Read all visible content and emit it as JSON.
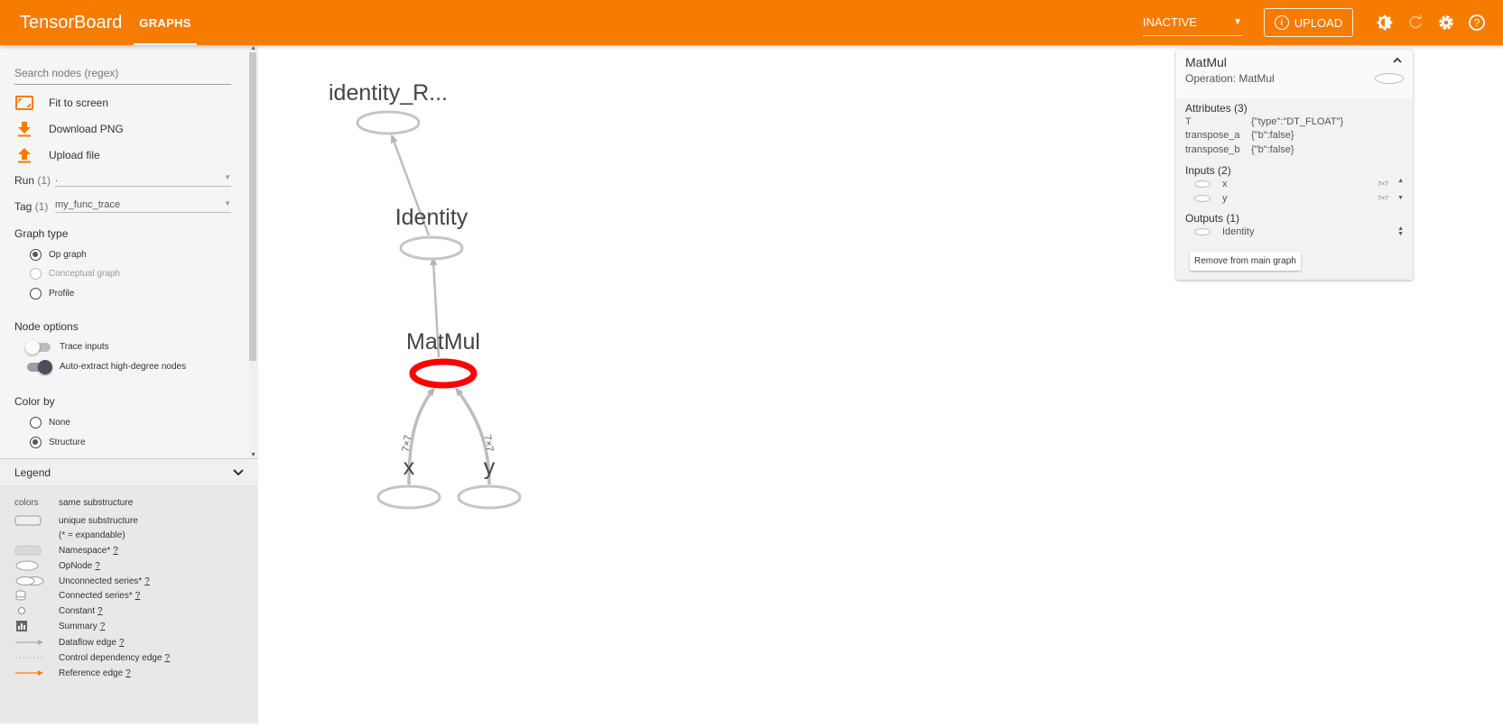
{
  "app": {
    "title": "TensorBoard"
  },
  "tabs": [
    {
      "label": "GRAPHS"
    }
  ],
  "topbar": {
    "status_value": "INACTIVE",
    "upload_label": "UPLOAD",
    "icons": [
      "theme-toggle-icon",
      "refresh-icon",
      "settings-icon",
      "help-icon"
    ],
    "accent_color": "#f57c00"
  },
  "sidebar": {
    "search_placeholder": "Search nodes (regex)",
    "actions": [
      {
        "label": "Fit to screen",
        "icon": "fit-screen-icon"
      },
      {
        "label": "Download PNG",
        "icon": "download-icon"
      },
      {
        "label": "Upload file",
        "icon": "upload-icon"
      }
    ],
    "run": {
      "label": "Run",
      "count": "(1)",
      "value": "."
    },
    "tag": {
      "label": "Tag",
      "count": "(1)",
      "value": "my_func_trace"
    },
    "graph_type": {
      "title": "Graph type",
      "options": [
        {
          "label": "Op graph",
          "checked": true,
          "disabled": false
        },
        {
          "label": "Conceptual graph",
          "checked": false,
          "disabled": true
        },
        {
          "label": "Profile",
          "checked": false,
          "disabled": false
        }
      ]
    },
    "node_options": {
      "title": "Node options",
      "toggles": [
        {
          "label": "Trace inputs",
          "on": false
        },
        {
          "label": "Auto-extract high-degree nodes",
          "on": true
        }
      ]
    },
    "color_by": {
      "title": "Color by",
      "options": [
        {
          "label": "None",
          "checked": false
        },
        {
          "label": "Structure",
          "checked": true
        }
      ]
    }
  },
  "legend": {
    "title": "Legend",
    "rows": [
      {
        "symbol": "colors",
        "label": "same substructure",
        "help": ""
      },
      {
        "symbol": "rounded-rect",
        "label": "unique substructure",
        "help": ""
      },
      {
        "symbol": "",
        "label": "(* = expandable)",
        "help": ""
      },
      {
        "symbol": "namespace-box",
        "label": "Namespace*",
        "help": "?"
      },
      {
        "symbol": "ellipse",
        "label": "OpNode",
        "help": "?"
      },
      {
        "symbol": "double-ellipse",
        "label": "Unconnected series*",
        "help": "?"
      },
      {
        "symbol": "stack",
        "label": "Connected series*",
        "help": "?"
      },
      {
        "symbol": "circle",
        "label": "Constant",
        "help": "?"
      },
      {
        "symbol": "summary",
        "label": "Summary",
        "help": "?"
      },
      {
        "symbol": "arrow",
        "label": "Dataflow edge",
        "help": "?"
      },
      {
        "symbol": "dashed",
        "label": "Control dependency edge",
        "help": "?"
      },
      {
        "symbol": "orange-arrow",
        "label": "Reference edge",
        "help": "?"
      }
    ]
  },
  "graph": {
    "nodes": [
      {
        "id": "identity_r",
        "label": "identity_R..."
      },
      {
        "id": "identity",
        "label": "Identity"
      },
      {
        "id": "matmul",
        "label": "MatMul",
        "selected": true
      },
      {
        "id": "x",
        "label": "x"
      },
      {
        "id": "y",
        "label": "y"
      }
    ],
    "edges": [
      {
        "from": "x",
        "to": "matmul",
        "label": "7×7"
      },
      {
        "from": "y",
        "to": "matmul",
        "label": "7×7"
      },
      {
        "from": "matmul",
        "to": "identity",
        "label": ""
      },
      {
        "from": "identity",
        "to": "identity_r",
        "label": ""
      }
    ],
    "selected_color": "#ff0000"
  },
  "info_card": {
    "title": "MatMul",
    "operation": "Operation: MatMul",
    "attributes_title": "Attributes (3)",
    "attributes": [
      {
        "key": "T",
        "value": "{\"type\":\"DT_FLOAT\"}"
      },
      {
        "key": "transpose_a",
        "value": "{\"b\":false}"
      },
      {
        "key": "transpose_b",
        "value": "{\"b\":false}"
      }
    ],
    "inputs_title": "Inputs (2)",
    "inputs": [
      {
        "name": "x",
        "shape": "7×7"
      },
      {
        "name": "y",
        "shape": "7×7"
      }
    ],
    "outputs_title": "Outputs (1)",
    "outputs": [
      {
        "name": "Identity"
      }
    ],
    "remove_label": "Remove from main graph"
  }
}
